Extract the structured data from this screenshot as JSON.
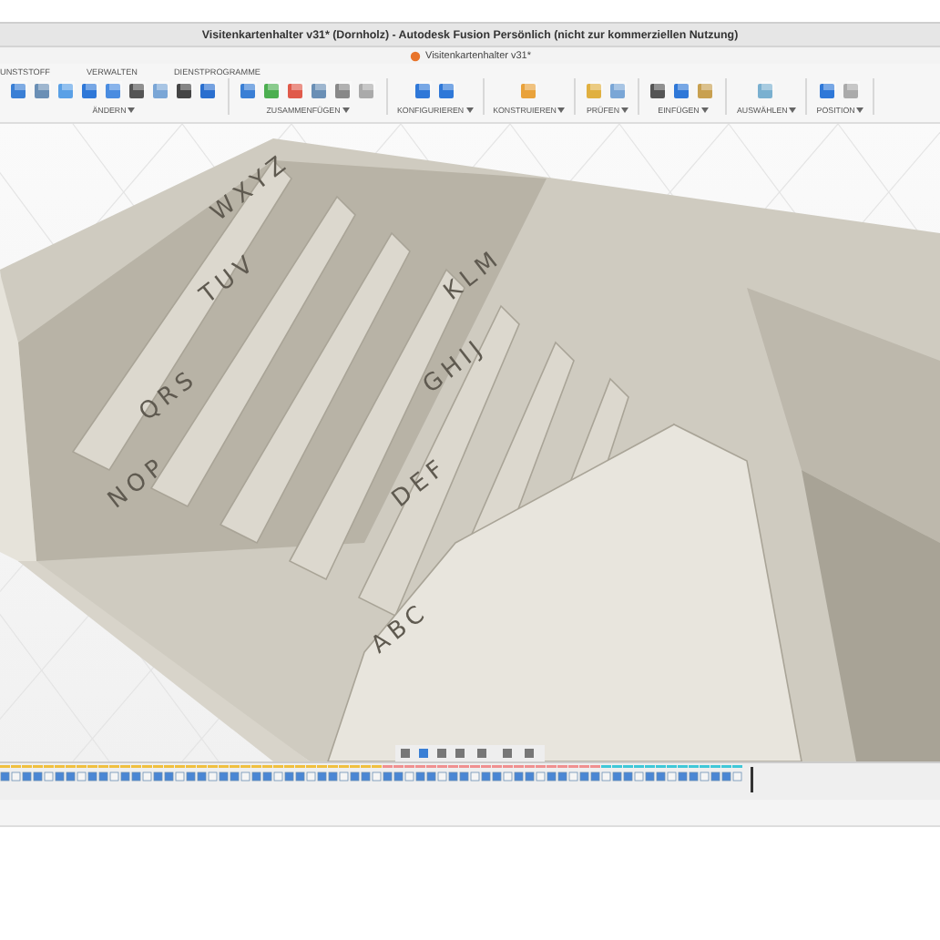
{
  "window": {
    "title": "Visitenkartenhalter v31* (Dornholz) - Autodesk Fusion Persönlich (nicht zur kommerziellen Nutzung)"
  },
  "document_tab": {
    "title": "Visitenkartenhalter v31*"
  },
  "toolbar": {
    "tabs": [
      "UNSTSTOFF",
      "VERWALTEN",
      "DIENSTPROGRAMME"
    ],
    "groups": [
      {
        "label": "ÄNDERN"
      },
      {
        "label": "ZUSAMMENFÜGEN"
      },
      {
        "label": "KONFIGURIEREN"
      },
      {
        "label": "KONSTRUIEREN"
      },
      {
        "label": "PRÜFEN"
      },
      {
        "label": "EINFÜGEN"
      },
      {
        "label": "AUSWÄHLEN"
      },
      {
        "label": "POSITION"
      }
    ]
  },
  "model": {
    "labels": [
      "WXYZ",
      "TUV",
      "QRS",
      "NOP",
      "KLM",
      "GHIJ",
      "DEF",
      "ABC"
    ]
  }
}
